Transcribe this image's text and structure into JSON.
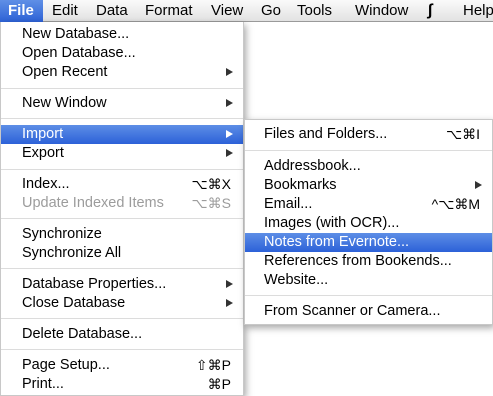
{
  "menubar": {
    "items": [
      "File",
      "Edit",
      "Data",
      "Format",
      "View",
      "Go",
      "Tools",
      "Window"
    ],
    "script_icon": "script-icon",
    "help": "Help"
  },
  "file_menu": {
    "items": [
      {
        "label": "New Database..."
      },
      {
        "label": "Open Database..."
      },
      {
        "label": "Open Recent",
        "submenu": true
      },
      {
        "label": "New Window",
        "submenu": true
      },
      {
        "label": "Import",
        "submenu": true,
        "highlight": true
      },
      {
        "label": "Export",
        "submenu": true
      },
      {
        "label": "Index...",
        "shortcut": "⌥⌘X"
      },
      {
        "label": "Update Indexed Items",
        "shortcut": "⌥⌘S",
        "disabled": true
      },
      {
        "label": "Synchronize"
      },
      {
        "label": "Synchronize All"
      },
      {
        "label": "Database Properties...",
        "submenu": true
      },
      {
        "label": "Close Database",
        "submenu": true
      },
      {
        "label": "Delete Database..."
      },
      {
        "label": "Page Setup...",
        "shortcut": "⇧⌘P"
      },
      {
        "label": "Print...",
        "shortcut": "⌘P"
      }
    ]
  },
  "import_menu": {
    "items": [
      {
        "label": "Files and Folders...",
        "shortcut": "⌥⌘I"
      },
      {
        "label": "Addressbook..."
      },
      {
        "label": "Bookmarks",
        "submenu": true
      },
      {
        "label": "Email...",
        "shortcut": "^⌥⌘M"
      },
      {
        "label": "Images (with OCR)..."
      },
      {
        "label": "Notes from Evernote...",
        "highlight": true
      },
      {
        "label": "References from Bookends..."
      },
      {
        "label": "Website..."
      },
      {
        "label": "From Scanner or Camera..."
      }
    ]
  },
  "colors": {
    "highlight": "#2c61d8",
    "menubar": "#e8e8e8"
  }
}
